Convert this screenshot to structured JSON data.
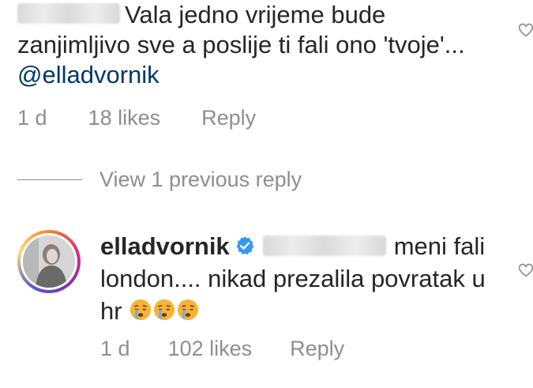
{
  "parent_comment": {
    "text": "Vala jedno vrijeme bude zanjimljivo sve a poslije ti fali ono 'tvoje'...",
    "mention": "@elladvornik",
    "time": "1 d",
    "likes": "18 likes",
    "reply_label": "Reply"
  },
  "view_replies": {
    "label": "View 1 previous reply"
  },
  "reply_comment": {
    "username": "elladvornik",
    "text_start": "meni",
    "text_rest": "fali london.... nikad prezalila povratak u hr",
    "emojis": [
      "crying-face",
      "crying-face",
      "crying-face"
    ],
    "time": "1 d",
    "likes": "102 likes",
    "reply_label": "Reply"
  },
  "colors": {
    "text": "#262626",
    "secondary": "#8e8e8e",
    "mention": "#00376b",
    "verified": "#3897f0"
  }
}
